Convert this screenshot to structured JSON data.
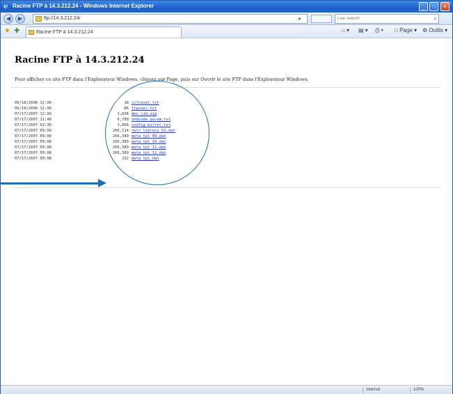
{
  "window": {
    "title": "Racine FTP à 14.3.212.24 - Windows Internet Explorer",
    "minimize": "_",
    "maximize": "□",
    "close": "×"
  },
  "address_bar": {
    "url": "ftp://14.3.212.24/",
    "search_placeholder": "Live Search"
  },
  "tab": {
    "label": "Racine FTP à 14.3.212.24"
  },
  "commands": {
    "page": "Page",
    "tools": "Outils"
  },
  "page": {
    "title": "Racine FTP à 14.3.212.24",
    "instructions": "Pour afficher ce site FTP dans l'Explorateur Windows, cliquez sur Page, puis sur Ouvrir le site FTP dans l'Explorateur Windows."
  },
  "listing": [
    {
      "date": "06/18/2008 12:00",
      "size": "18",
      "name": "cifsuser.txt"
    },
    {
      "date": "06/18/2008 12:00",
      "size": "86",
      "name": "ftpuser.txt"
    },
    {
      "date": "07/17/2007 12:00",
      "size": "1,836",
      "name": "dmc_lib.zip"
    },
    {
      "date": "07/17/2007 11:48",
      "size": "6,780",
      "name": "cmdcode_param.txt"
    },
    {
      "date": "07/17/2007 02:30",
      "size": "1,866",
      "name": "config_mirror.txt"
    },
    {
      "date": "07/17/2007 09:00",
      "size": "266,114",
      "name": "retr_library_01.dat"
    },
    {
      "date": "07/17/2007 09:08",
      "size": "266,389",
      "name": "meta_tpl_09.dat"
    },
    {
      "date": "07/17/2007 09:08",
      "size": "266,389",
      "name": "meta_tpl_10.dat"
    },
    {
      "date": "07/17/2007 09:08",
      "size": "266,389",
      "name": "meta_tpl_11.dat"
    },
    {
      "date": "07/17/2007 09:08",
      "size": "266,389",
      "name": "meta_tpl_12.dat"
    },
    {
      "date": "07/17/2007 09:08",
      "size": "132",
      "name": "meta_tpl.dat"
    }
  ],
  "status": {
    "zone": "Internet",
    "zoom": "100%"
  },
  "colors": {
    "annotation": "#1a72b8",
    "link": "#1a3fa8"
  }
}
